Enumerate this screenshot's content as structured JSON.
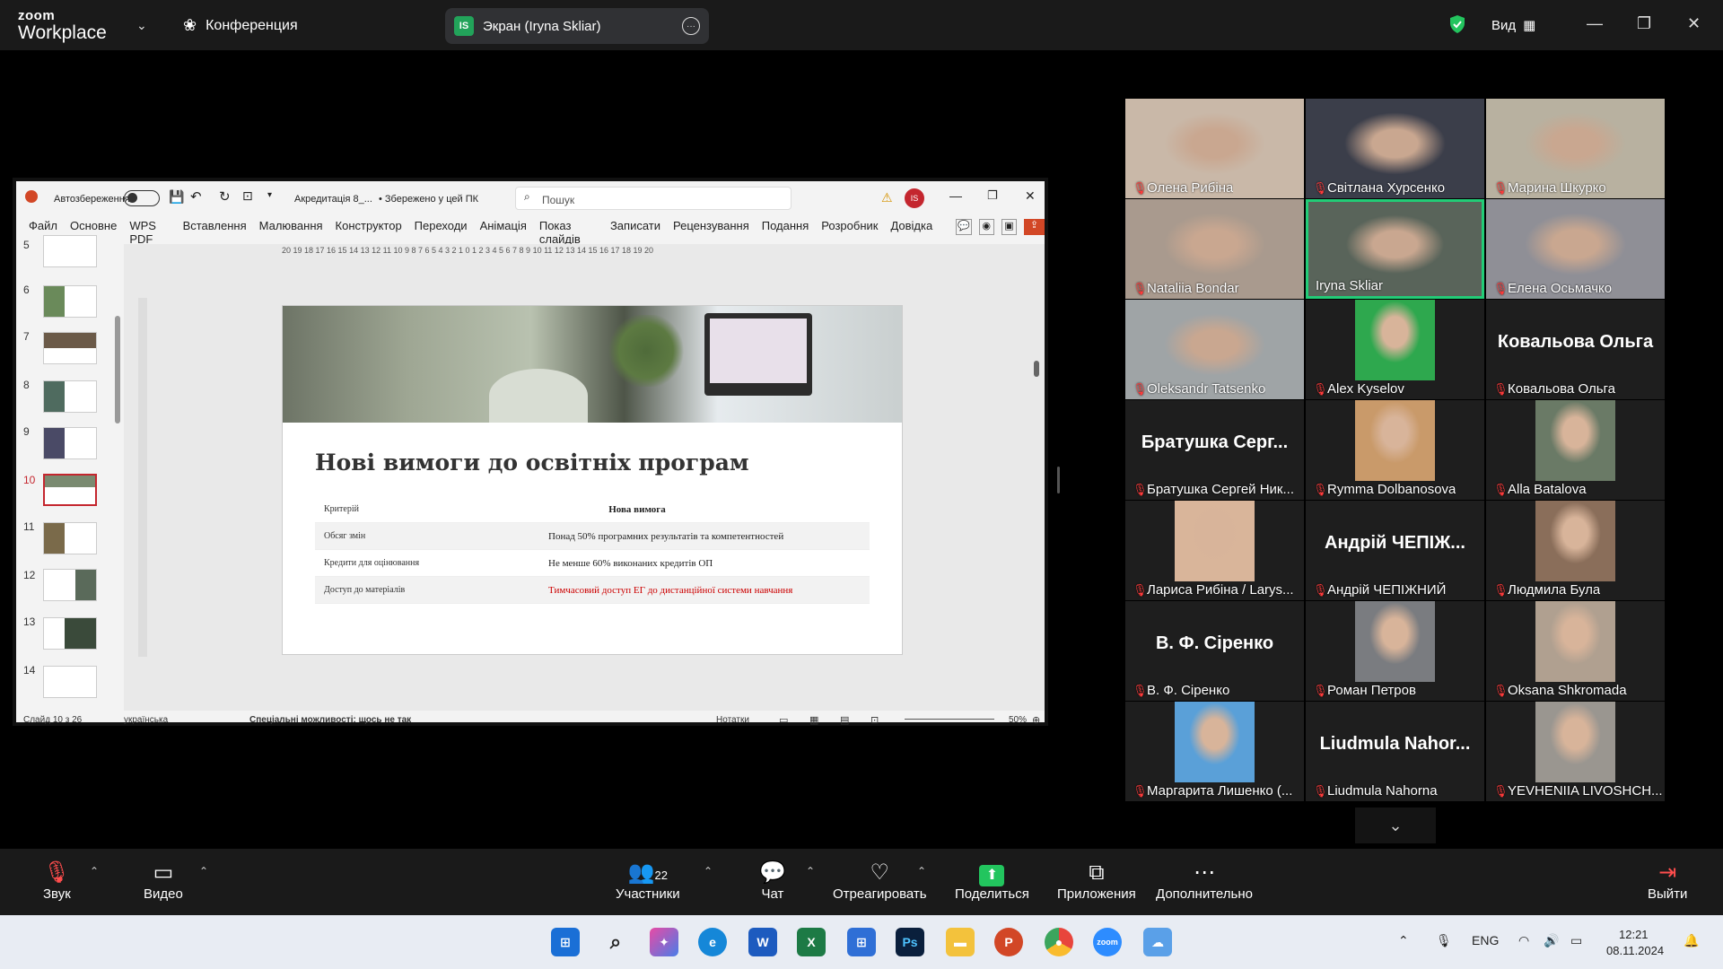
{
  "zoom": {
    "logo_top": "zoom",
    "logo_bottom": "Workplace",
    "conference": "Конференция",
    "screen_share": "Экран (Iryna Skliar)",
    "screen_badge": "IS",
    "view": "Вид"
  },
  "ppt": {
    "autosave": "Автозбереження",
    "filename": "Акредитація 8_...",
    "saved": "• Збережено у цей ПК",
    "search": "Пошук",
    "user_badge": "IS",
    "menu": [
      "Файл",
      "Основне",
      "WPS PDF",
      "Вставлення",
      "Малювання",
      "Конструктор",
      "Переходи",
      "Анімація",
      "Показ слайдів",
      "Записати",
      "Рецензування",
      "Подання",
      "Розробник",
      "Довідка"
    ],
    "ruler": "20 19 18 17 16 15 14 13 12 11 10 9 8 7 6 5 4 3 2 1 0 1 2 3 4 5 6 7 8 9 10 11 12 13 14 15 16 17 18 19 20",
    "thumbs": [
      "5",
      "6",
      "7",
      "8",
      "9",
      "10",
      "11",
      "12",
      "13",
      "14"
    ],
    "slide": {
      "title": "Нові вимоги до освітніх програм",
      "rows": [
        [
          "Критерій",
          "Нова вимога"
        ],
        [
          "Обсяг змін",
          "Понад 50% програмних результатів та компетентностей"
        ],
        [
          "Кредити для оцінювання",
          "Не менше 60% виконаних кредитів ОП"
        ],
        [
          "Доступ до матеріалів",
          "Тимчасовий доступ ЕГ до дистанційної системи навчання"
        ]
      ]
    },
    "status": {
      "slide": "Слайд 10 з 26",
      "lang": "українська",
      "access": "Спеціальні можливості: щось не так",
      "notes": "Нотатки",
      "zoom": "50%"
    }
  },
  "participants": [
    {
      "name": "Олена Рибіна",
      "type": "video",
      "bg": "#c9b8a8"
    },
    {
      "name": "Світлана Хурсенко",
      "type": "video",
      "bg": "#3b3e4a"
    },
    {
      "name": "Марина Шкурко",
      "type": "video",
      "bg": "#b8b1a0"
    },
    {
      "name": "Nataliia Bondar",
      "type": "video",
      "bg": "#a99a8e"
    },
    {
      "name": "Iryna Skliar",
      "type": "video",
      "bg": "#59645a",
      "selected": true
    },
    {
      "name": "Елена Осьмачко",
      "type": "video",
      "bg": "#8f8f96"
    },
    {
      "name": "Oleksandr Tatsenko",
      "type": "video",
      "bg": "#9fa4a6"
    },
    {
      "name": "Alex Kyselov",
      "type": "photo",
      "bg": "#2ea84e"
    },
    {
      "name": "Ковальова Ольга",
      "type": "name",
      "big": "Ковальова Ольга"
    },
    {
      "name": "Братушка Сергей Ник...",
      "type": "name",
      "big": "Братушка Серг..."
    },
    {
      "name": "Rymma Dolbanosova",
      "type": "photo",
      "bg": "#c99a6a"
    },
    {
      "name": "Alla Batalova",
      "type": "photo",
      "bg": "#6a7a66"
    },
    {
      "name": "Лариса Рибіна / Larys...",
      "type": "photo",
      "bg": "#d9b59a"
    },
    {
      "name": "Андрій ЧЕПІЖНИЙ",
      "type": "name",
      "big": "Андрій ЧЕПІЖ..."
    },
    {
      "name": "Людмила Була",
      "type": "photo",
      "bg": "#8a6e5a"
    },
    {
      "name": "В. Ф. Сіренко",
      "type": "name",
      "big": "В. Ф. Сіренко"
    },
    {
      "name": "Роман Петров",
      "type": "photo",
      "bg": "#7a7c80"
    },
    {
      "name": "Oksana Shkromada",
      "type": "photo",
      "bg": "#b0a090"
    },
    {
      "name": "Маргарита Лишенко (...",
      "type": "photo",
      "bg": "#5aa0d8"
    },
    {
      "name": "Liudmula Nahorna",
      "type": "name",
      "big": "Liudmula Nahor..."
    },
    {
      "name": "YEVHENIIA LIVOSHCH...",
      "type": "photo",
      "bg": "#9a9690"
    }
  ],
  "toolbar": {
    "audio": "Звук",
    "video": "Видео",
    "participants": "Участники",
    "participants_count": "22",
    "chat": "Чат",
    "react": "Отреагировать",
    "share": "Поделиться",
    "apps": "Приложения",
    "more": "Дополнительно",
    "leave": "Выйти"
  },
  "taskbar": {
    "lang": "ENG",
    "time": "12:21",
    "date": "08.11.2024"
  }
}
